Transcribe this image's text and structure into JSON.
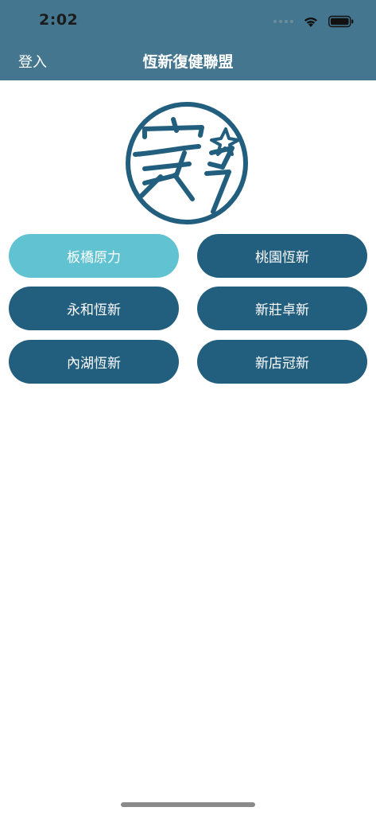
{
  "status_bar": {
    "time": "2:02"
  },
  "header": {
    "login_label": "登入",
    "title": "恆新復健聯盟"
  },
  "colors": {
    "header_bg": "#44778f",
    "button_primary": "#225e7e",
    "button_selected": "#61c3d2",
    "logo": "#225e7e"
  },
  "stores": [
    {
      "label": "板橋原力",
      "selected": true
    },
    {
      "label": "桃園恆新",
      "selected": false
    },
    {
      "label": "永和恆新",
      "selected": false
    },
    {
      "label": "新莊卓新",
      "selected": false
    },
    {
      "label": "內湖恆新",
      "selected": false
    },
    {
      "label": "新店冠新",
      "selected": false
    }
  ]
}
